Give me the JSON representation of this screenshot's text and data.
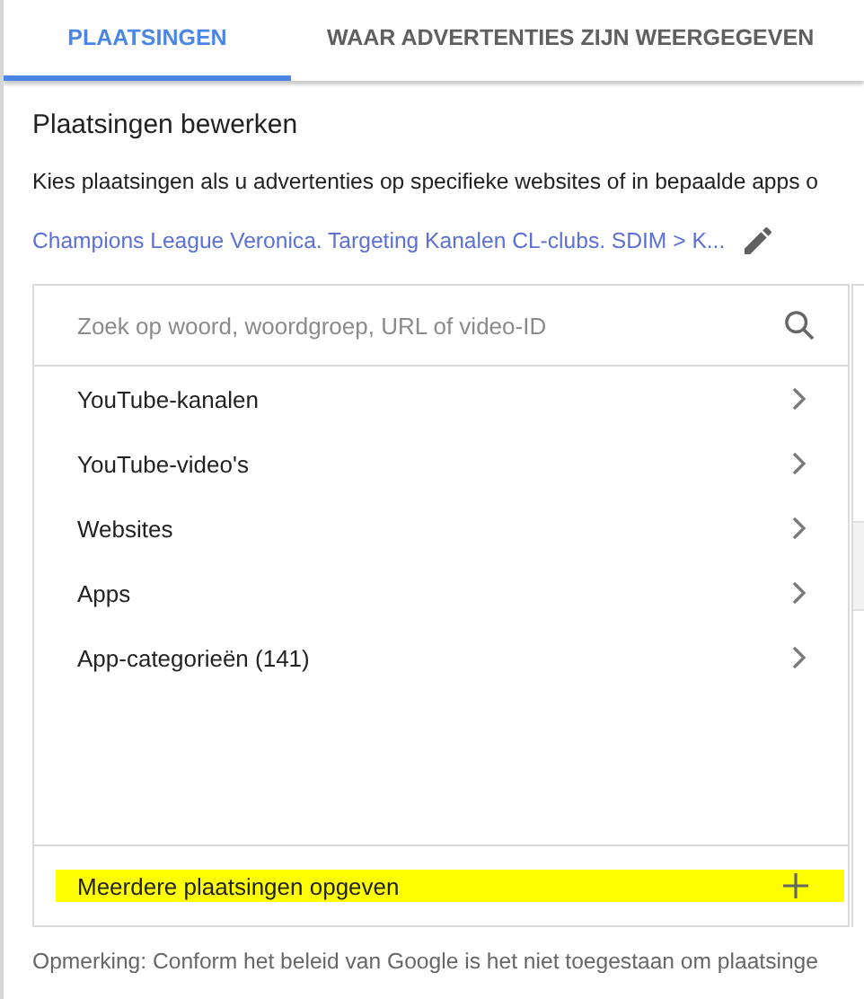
{
  "tabs": [
    {
      "label": "PLAATSINGEN",
      "selected": true
    },
    {
      "label": "WAAR ADVERTENTIES ZIJN WEERGEGEVEN",
      "selected": false
    }
  ],
  "heading": "Plaatsingen bewerken",
  "description": "Kies plaatsingen als u advertenties op specifieke websites of in bepaalde apps o",
  "breadcrumb": "Champions League Veronica. Targeting Kanalen CL-clubs. SDIM > K...",
  "search": {
    "placeholder": "Zoek op woord, woordgroep, URL of video-ID"
  },
  "categories": [
    {
      "label": "YouTube-kanalen"
    },
    {
      "label": "YouTube-video's"
    },
    {
      "label": "Websites"
    },
    {
      "label": "Apps"
    },
    {
      "label": "App-categorieën (141)"
    }
  ],
  "add_row": {
    "label": "Meerdere plaatsingen opgeven",
    "highlighted": true
  },
  "note": "Opmerking: Conform het beleid van Google is het niet toegestaan om plaatsinge"
}
